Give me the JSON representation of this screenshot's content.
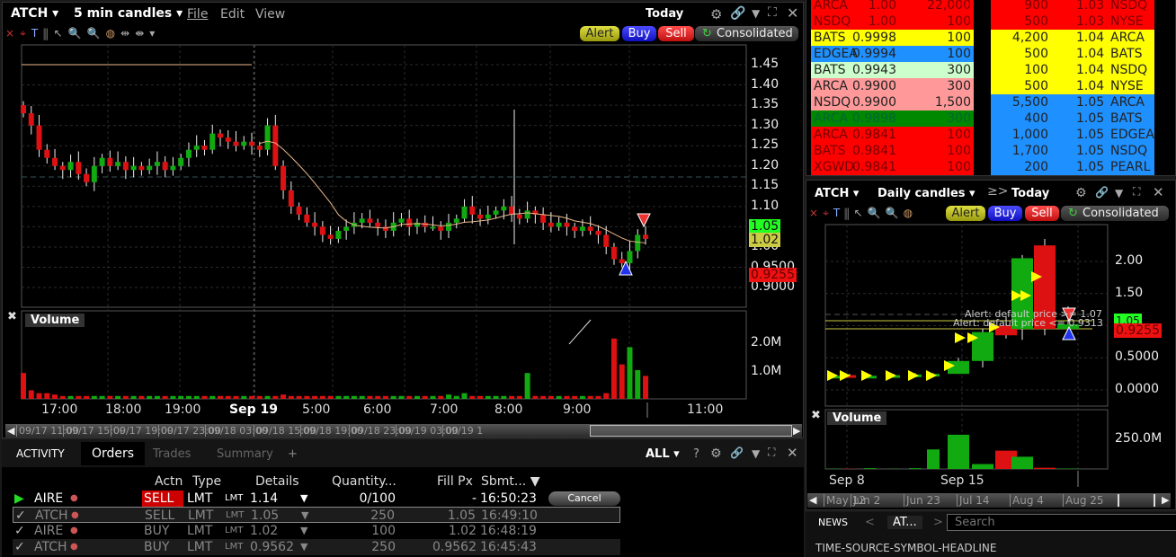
{
  "main_chart": {
    "symbol": "ATCH",
    "bar_size": "5 min candles",
    "menu": [
      "File",
      "Edit",
      "View"
    ],
    "period": "Today",
    "buttons": {
      "alert": "Alert",
      "buy": "Buy",
      "sell": "Sell",
      "consolidated": "Consolidated"
    },
    "price_ticks": [
      "1.45",
      "1.40",
      "1.35",
      "1.30",
      "1.25",
      "1.20",
      "1.15",
      "1.10",
      "1.05",
      "1.00",
      "0.9500",
      "0.9000"
    ],
    "price_tags": {
      "ask": "1.05",
      "last": "1.02",
      "bid": "0.9255"
    },
    "volume_label": "Volume",
    "volume_ticks": [
      "2.0M",
      "1.0M"
    ],
    "time_ticks": [
      "17:00",
      "18:00",
      "19:00",
      "Sep 19",
      "5:00",
      "6:00",
      "7:00",
      "8:00",
      "9:00",
      "11:00"
    ],
    "scroll_ticks": [
      "09/17 11:00",
      "09/17 15:00",
      "09/17 19:00",
      "09/17 23:00",
      "09/18 03:00",
      "09/18 15:00",
      "09/18 19:00",
      "09/18 23:00",
      "09/19 03:00",
      "09/19 1"
    ],
    "chart_data": {
      "type": "candlestick",
      "ylim": [
        0.9,
        1.45
      ],
      "closes": [
        1.33,
        1.3,
        1.24,
        1.22,
        1.2,
        1.19,
        1.21,
        1.18,
        1.16,
        1.2,
        1.22,
        1.2,
        1.21,
        1.19,
        1.2,
        1.19,
        1.2,
        1.21,
        1.19,
        1.2,
        1.22,
        1.24,
        1.25,
        1.24,
        1.28,
        1.27,
        1.26,
        1.25,
        1.26,
        1.25,
        1.24,
        1.3,
        1.2,
        1.14,
        1.1,
        1.08,
        1.06,
        1.05,
        1.03,
        1.02,
        1.04,
        1.05,
        1.06,
        1.07,
        1.06,
        1.05,
        1.04,
        1.06,
        1.07,
        1.05,
        1.06,
        1.05,
        1.05,
        1.04,
        1.06,
        1.07,
        1.1,
        1.08,
        1.07,
        1.08,
        1.09,
        1.1,
        1.08,
        1.07,
        1.09,
        1.08,
        1.06,
        1.05,
        1.06,
        1.05,
        1.04,
        1.05,
        1.04,
        1.03,
        1.0,
        0.97,
        0.96,
        0.99,
        1.03,
        1.02
      ],
      "volumes_m": [
        0.9,
        0.3,
        0.2,
        0.2,
        0.15,
        0.1,
        0.1,
        0.1,
        0.1,
        0.1,
        0.1,
        0.1,
        0.1,
        0.1,
        0.1,
        0.1,
        0.1,
        0.1,
        0.1,
        0.1,
        0.1,
        0.1,
        0.1,
        0.1,
        0.1,
        0.1,
        0.1,
        0.1,
        0.1,
        0.1,
        0.1,
        0.1,
        0.1,
        0.15,
        0.1,
        0.1,
        0.1,
        0.1,
        0.1,
        0.1,
        0.1,
        0.1,
        0.1,
        0.1,
        0.1,
        0.1,
        0.1,
        0.1,
        0.1,
        0.1,
        0.1,
        0.1,
        0.1,
        0.1,
        0.15,
        0.1,
        0.2,
        0.1,
        0.1,
        0.1,
        0.1,
        0.1,
        0.1,
        0.1,
        0.9,
        0.1,
        0.1,
        0.1,
        0.1,
        0.1,
        0.1,
        0.1,
        0.1,
        0.1,
        0.2,
        2.1,
        1.2,
        1.8,
        1.0,
        0.8
      ]
    }
  },
  "order_book": {
    "bids": [
      [
        "ARCA",
        "1.00",
        "22,000",
        "#ff0000"
      ],
      [
        "NSDQ",
        "1.00",
        "100",
        "#ff0000"
      ],
      [
        "BATS",
        "0.9998",
        "100",
        "#ffff00"
      ],
      [
        "EDGEA",
        "0.9994",
        "100",
        "#1e90ff"
      ],
      [
        "BATS",
        "0.9943",
        "300",
        "#ccffcc"
      ],
      [
        "ARCA",
        "0.9900",
        "300",
        "#ff9999"
      ],
      [
        "NSDQ",
        "0.9900",
        "1,500",
        "#ff9999"
      ],
      [
        "ARCA",
        "0.9898",
        "300",
        "#008800"
      ],
      [
        "ARCA",
        "0.9841",
        "100",
        "#ff0000"
      ],
      [
        "BATS",
        "0.9841",
        "100",
        "#ff0000"
      ],
      [
        "XGWD",
        "0.9841",
        "100",
        "#ff0000"
      ]
    ],
    "asks": [
      [
        "900",
        "1.03",
        "NSDQ",
        "#ff0000"
      ],
      [
        "500",
        "1.03",
        "NYSE",
        "#ff0000"
      ],
      [
        "4,200",
        "1.04",
        "ARCA",
        "#ffff00"
      ],
      [
        "500",
        "1.04",
        "BATS",
        "#ffff00"
      ],
      [
        "100",
        "1.04",
        "NSDQ",
        "#ffff00"
      ],
      [
        "500",
        "1.04",
        "NYSE",
        "#ffff00"
      ],
      [
        "5,500",
        "1.05",
        "ARCA",
        "#1e90ff"
      ],
      [
        "400",
        "1.05",
        "BATS",
        "#1e90ff"
      ],
      [
        "1,000",
        "1.05",
        "EDGEA",
        "#1e90ff"
      ],
      [
        "1,700",
        "1.05",
        "NSDQ",
        "#1e90ff"
      ],
      [
        "200",
        "1.05",
        "PEARL",
        "#1e90ff"
      ]
    ]
  },
  "daily_chart": {
    "symbol": "ATCH",
    "bar_size": "Daily candles",
    "period": "Today",
    "buttons": {
      "alert": "Alert",
      "buy": "Buy",
      "sell": "Sell",
      "consolidated": "Consolidated"
    },
    "price_ticks": [
      "2.00",
      "1.50",
      "1.00",
      "0.5000",
      "0.0000"
    ],
    "alerts": [
      "Alert: default price >= 1.07",
      "Alert: default price <= 0.9313"
    ],
    "price_tags": {
      "ask": "1.05",
      "bid": "0.9255"
    },
    "volume_label": "Volume",
    "volume_ticks": [
      "250.0M"
    ],
    "time_ticks": [
      "Sep 8",
      "Sep 15"
    ],
    "scroll_ticks": [
      "May 12",
      "Jun 2",
      "Jun 23",
      "Jul 14",
      "Aug 4",
      "Aug 25"
    ],
    "chart_data": {
      "type": "candlestick",
      "ylim": [
        -0.15,
        2.4
      ],
      "ohlc": [
        [
          0.22,
          0.24,
          0.2,
          0.22
        ],
        [
          0.23,
          0.25,
          0.21,
          0.22
        ],
        [
          0.22,
          0.24,
          0.2,
          0.22
        ],
        [
          0.22,
          0.25,
          0.2,
          0.23
        ],
        [
          0.22,
          0.26,
          0.2,
          0.24
        ],
        [
          0.23,
          0.26,
          0.2,
          0.25
        ],
        [
          0.25,
          0.5,
          0.25,
          0.45
        ],
        [
          0.45,
          0.95,
          0.35,
          0.9
        ],
        [
          1.0,
          1.15,
          0.8,
          0.85
        ],
        [
          0.95,
          2.1,
          0.78,
          2.05
        ],
        [
          2.25,
          2.35,
          0.85,
          0.95
        ],
        [
          0.95,
          1.3,
          0.9,
          1.02
        ]
      ],
      "volumes_m": [
        2,
        2,
        6,
        2,
        6,
        160,
        280,
        40,
        150,
        100,
        10,
        3
      ]
    }
  },
  "activity": {
    "tabs": [
      "ACTIVITY",
      "Orders",
      "Trades",
      "Summary",
      "+"
    ],
    "filter": "ALL",
    "columns": [
      "Actn",
      "Type",
      "Details",
      "Quantity...",
      "Fill Px",
      "Sbmt..."
    ],
    "orders": [
      {
        "symbol": "AIRE",
        "action": "SELL",
        "type": "LMT",
        "details_type": "LMT",
        "details_price": "1.14",
        "quantity": "0/100",
        "fill": "-",
        "time": "16:50:23",
        "cancel": "Cancel"
      },
      {
        "symbol": "ATCH",
        "action": "SELL",
        "type": "LMT",
        "details_type": "LMT",
        "details_price": "1.05",
        "quantity": "250",
        "fill": "1.05",
        "time": "16:49:10"
      },
      {
        "symbol": "AIRE",
        "action": "BUY",
        "type": "LMT",
        "details_type": "LMT",
        "details_price": "1.02",
        "quantity": "100",
        "fill": "1.02",
        "time": "16:48:19"
      },
      {
        "symbol": "ATCH",
        "action": "BUY",
        "type": "LMT",
        "details_type": "LMT",
        "details_price": "0.9562",
        "quantity": "250",
        "fill": "0.9562",
        "time": "16:45:43"
      }
    ]
  },
  "news": {
    "tab": "NEWS",
    "symbol_tab": "AT...",
    "search_placeholder": "Search",
    "header": "TIME-SOURCE-SYMBOL-HEADLINE"
  }
}
